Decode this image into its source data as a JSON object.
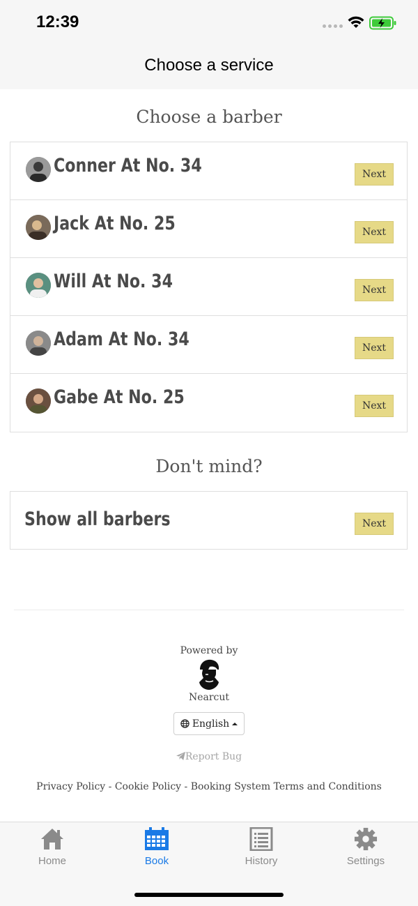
{
  "status": {
    "time": "12:39"
  },
  "nav": {
    "title": "Choose a service"
  },
  "barbers_heading": "Choose a barber",
  "barbers": [
    {
      "name": "Conner At No. 34",
      "button": "Next"
    },
    {
      "name": "Jack At No. 25",
      "button": "Next"
    },
    {
      "name": "Will At No. 34",
      "button": "Next"
    },
    {
      "name": "Adam At No. 34",
      "button": "Next"
    },
    {
      "name": "Gabe At No. 25",
      "button": "Next"
    }
  ],
  "dont_mind_heading": "Don't mind?",
  "show_all": {
    "label": "Show all barbers",
    "button": "Next"
  },
  "footer": {
    "powered_by": "Powered by",
    "brand": "Nearcut",
    "language": "English",
    "report_bug": "Report Bug",
    "legal": "Privacy Policy - Cookie Policy - Booking System Terms and Conditions"
  },
  "tabs": [
    {
      "label": "Home",
      "icon": "home-icon",
      "active": false
    },
    {
      "label": "Book",
      "icon": "calendar-icon",
      "active": true
    },
    {
      "label": "History",
      "icon": "list-document-icon",
      "active": false
    },
    {
      "label": "Settings",
      "icon": "gear-icon",
      "active": false
    }
  ],
  "colors": {
    "accent": "#1a7ae6",
    "next_button": "#e6d987",
    "battery": "#3ecb3a"
  }
}
